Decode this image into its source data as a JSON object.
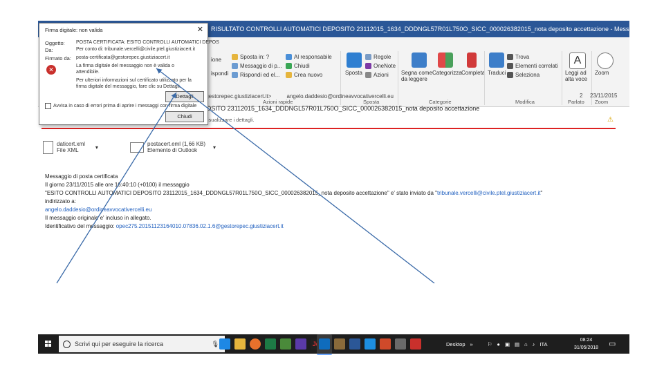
{
  "window": {
    "title": "RISULTATO CONTROLLI AUTOMATICI DEPOSITO 23112015_1634_DDDNGL57R01L750O_SICC_000026382015_nota deposito accettazione - Messaggio",
    "tell_me": "?"
  },
  "ribbon": {
    "respond_fragments": [
      "ispondi",
      "ione"
    ],
    "quick_steps": [
      "Sposta in: ?",
      "Messaggio di p...",
      "Rispondi ed el..."
    ],
    "quick_steps2": [
      "Al responsabile",
      "Chiudi",
      "Crea nuovo"
    ],
    "move_label": "Sposta",
    "move_items": [
      "Regole",
      "OneNote",
      "Azioni"
    ],
    "tags": [
      "Segna come da leggere",
      "Categorizza",
      "Completa"
    ],
    "translate": "Traduci",
    "edit_items": [
      "Trova",
      "Elementi correlati",
      "Seleziona"
    ],
    "read_aloud": "Leggi ad alta voce",
    "zoom": "Zoom",
    "groups": {
      "quick_steps": "Azioni rapide",
      "move": "Sposta",
      "tags": "Categorie",
      "editing": "Modifica",
      "speech": "Parlato",
      "zoom": "Zoom"
    }
  },
  "message": {
    "from_line": "certificata@gestorepec.giustiziacert.it>",
    "to_line": "angelo.daddesio@ordineavvocativercelli.eu",
    "subject": "ATICI DEPOSITO 23112015_1634_DDDNGL57R01L750O_SICC_000026382015_nota deposito accettazione",
    "info": "lla firma per visualizzare i dettagli.",
    "reply_count": "2",
    "date": "23/11/2015",
    "attachments": [
      {
        "name": "daticert.xml",
        "type": "File XML"
      },
      {
        "name": "postacert.eml (1,66 KB)",
        "type": "Elemento di Outlook"
      }
    ],
    "body": {
      "line1": "Messaggio di posta certificata",
      "line2": "Il giorno 23/11/2015 alle ore 16:40:10 (+0100) il messaggio",
      "line3a": "\"ESITO CONTROLLI AUTOMATICI DEPOSITO 23112015_1634_DDDNGL57R01L750O_SICC_000026382015_nota deposito accettazione\" e' stato inviato da \"",
      "line3_link": "tribunale.vercelli@civile.ptel.giustiziacert.it",
      "line3b": "\"",
      "line4": "indirizzato a:",
      "line5_link": "angelo.daddesio@ordineavvocativercelli.eu",
      "line6": "Il messaggio originale e' incluso in allegato.",
      "line7a": "Identificativo del messaggio: ",
      "line7_link": "opec275.20151123164010.07836.02.1.6@gestorepec.giustiziacert.it"
    }
  },
  "dialog": {
    "title": "Firma digitale: non valida",
    "subject_label": "Oggetto:",
    "subject_value": "POSTA CERTIFICATA: ESITO CONTROLLI AUTOMATICI DEPOS",
    "from_label": "Da:",
    "from_value": "Per conto di: tribunale.vercelli@civile.ptel.giustiziacert.it",
    "signer_label": "Firmato da:",
    "signer_value": "posta-certificata@gestorepec.giustiziacert.it",
    "warning": "La firma digitale del messaggio non è valida o",
    "warning2": "attendibile.",
    "info1": "Per ulteriori informazioni sul certificato utilizzato per la",
    "info2": "firma digitale del messaggio, fare clic su Dettagli.",
    "details_button": "Dettagli",
    "close_button": "Chiudi",
    "checkbox_label": "Avvisa in caso di errori prima di aprire i messaggi con firma digitale"
  },
  "taskbar": {
    "search_placeholder": "Scrivi qui per eseguire la ricerca",
    "desktop_label": "Desktop",
    "language": "ITA",
    "time": "08:24",
    "date": "31/05/2018"
  },
  "colors": {
    "titlebar": "#2b5797",
    "red_bar": "#d22222",
    "arrow": "#3a6aa8",
    "link": "#1f5fbf"
  }
}
